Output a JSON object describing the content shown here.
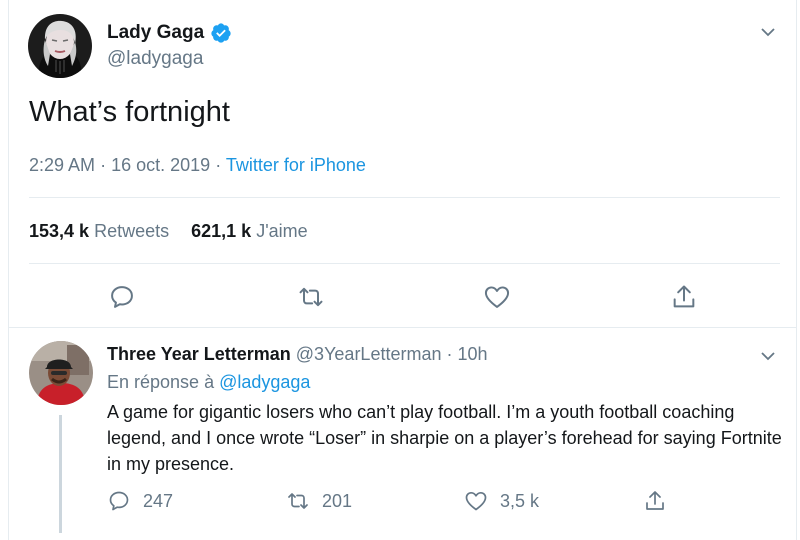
{
  "tweet": {
    "author_name": "Lady Gaga",
    "author_handle": "@ladygaga",
    "text": "What’s fortnight",
    "time": "2:29 AM",
    "date": "16 oct. 2019",
    "separator": "·",
    "source": "Twitter for iPhone",
    "retweet_count": "153,4 k",
    "retweet_label": "Retweets",
    "like_count": "621,1 k",
    "like_label": "J'aime",
    "icons": [
      "verified-badge-icon",
      "chevron-down-icon",
      "reply-icon",
      "retweet-icon",
      "like-icon",
      "share-icon"
    ]
  },
  "reply": {
    "author_name": "Three Year Letterman",
    "author_handle": "@3YearLetterman",
    "separator": "·",
    "age": "10h",
    "replying_prefix": "En réponse à",
    "replying_to": "@ladygaga",
    "text": "A game for gigantic losers who can’t play football. I’m a youth football coaching legend, and I once wrote “Loser” in sharpie on a player’s forehead for saying Fortnite in my presence.",
    "reply_count": "247",
    "retweet_count": "201",
    "like_count": "3,5 k"
  },
  "colors": {
    "link": "#1b95e0",
    "secondary_text": "#657786",
    "primary_text": "#14171a",
    "divider": "#e6ecf0",
    "thread_line": "#ccd6dd"
  }
}
